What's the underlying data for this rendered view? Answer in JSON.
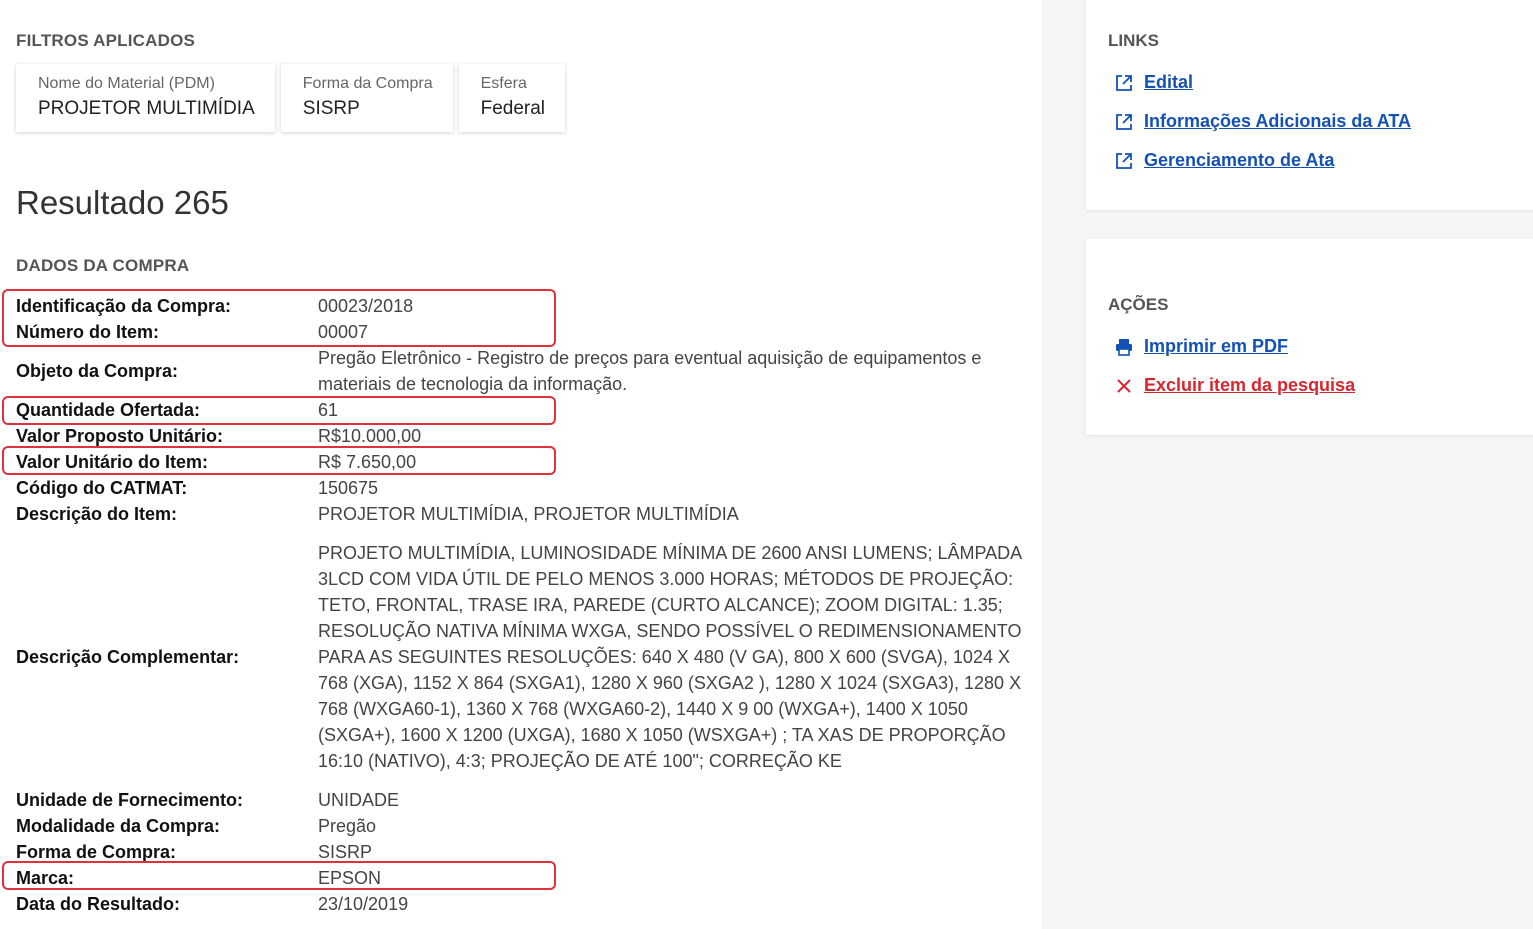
{
  "filters": {
    "title": "FILTROS APLICADOS",
    "items": [
      {
        "label": "Nome do Material (PDM)",
        "value": "PROJETOR MULTIMÍDIA"
      },
      {
        "label": "Forma da Compra",
        "value": "SISRP"
      },
      {
        "label": "Esfera",
        "value": "Federal"
      }
    ]
  },
  "result": {
    "title": "Resultado 265"
  },
  "dados": {
    "title": "DADOS DA COMPRA",
    "rows": [
      {
        "label": "Identificação da Compra:",
        "value": "00023/2018"
      },
      {
        "label": "Número do Item:",
        "value": "00007"
      },
      {
        "label": "Objeto da Compra:",
        "value": "Pregão Eletrônico - Registro de preços para eventual aquisição de equipamentos e materiais de tecnologia da informação."
      },
      {
        "label": "Quantidade Ofertada:",
        "value": "61"
      },
      {
        "label": "Valor Proposto Unitário:",
        "value": "R$10.000,00"
      },
      {
        "label": "Valor Unitário do Item:",
        "value": "R$ 7.650,00"
      },
      {
        "label": "Código do CATMAT:",
        "value": "150675"
      },
      {
        "label": "Descrição do Item:",
        "value": "PROJETOR MULTIMÍDIA, PROJETOR MULTIMÍDIA"
      },
      {
        "label": "Descrição Complementar:",
        "value": "PROJETO MULTIMÍDIA, LUMINOSIDADE MÍNIMA DE 2600 ANSI LUMENS; LÂMPADA 3LCD COM VIDA ÚTIL DE PELO MENOS 3.000 HORAS; MÉTODOS DE PROJEÇÃO: TETO, FRONTAL, TRASE IRA, PAREDE (CURTO ALCANCE); ZOOM DIGITAL: 1.35; RESOLUÇÃO NATIVA MÍNIMA WXGA, SENDO POSSÍVEL O REDIMENSIONAMENTO PARA AS SEGUINTES RESOLUÇÕES: 640 X 480 (V GA), 800 X 600 (SVGA), 1024 X 768 (XGA), 1152 X 864 (SXGA1), 1280 X 960 (SXGA2 ), 1280 X 1024 (SXGA3), 1280 X 768 (WXGA60-1), 1360 X 768 (WXGA60-2), 1440 X 9 00 (WXGA+), 1400 X 1050 (SXGA+), 1600 X 1200 (UXGA), 1680 X 1050 (WSXGA+) ; TA XAS DE PROPORÇÃO 16:10 (NATIVO), 4:3; PROJEÇÃO DE ATÉ 100\"; CORREÇÃO KE"
      },
      {
        "label": "Unidade de Fornecimento:",
        "value": "UNIDADE"
      },
      {
        "label": "Modalidade da Compra:",
        "value": "Pregão"
      },
      {
        "label": "Forma de Compra:",
        "value": "SISRP"
      },
      {
        "label": "Marca:",
        "value": "EPSON"
      },
      {
        "label": "Data do Resultado:",
        "value": "23/10/2019"
      }
    ]
  },
  "links": {
    "title": "LINKS",
    "items": [
      {
        "label": "Edital",
        "icon": "external-link-icon"
      },
      {
        "label": "Informações Adicionais da ATA",
        "icon": "external-link-icon"
      },
      {
        "label": "Gerenciamento de Ata",
        "icon": "external-link-icon"
      }
    ]
  },
  "acoes": {
    "title": "AÇÕES",
    "print_label": "Imprimir em PDF",
    "print_icon": "printer-icon",
    "delete_label": "Excluir item da pesquisa",
    "delete_icon": "close-icon"
  },
  "colors": {
    "link_blue": "#1351b4",
    "danger_red": "#d7262e",
    "highlight_red": "#e0323c"
  }
}
